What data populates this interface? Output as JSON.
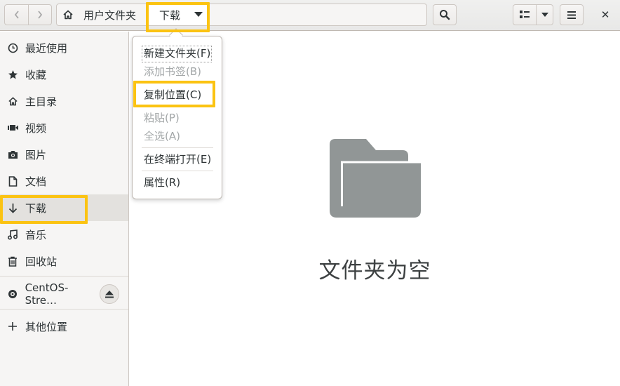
{
  "header": {
    "path_home_label": "用户文件夹",
    "path_current_label": "下载",
    "close_label": "✕"
  },
  "sidebar": {
    "items": [
      {
        "label": "最近使用",
        "icon": "clock-icon"
      },
      {
        "label": "收藏",
        "icon": "star-icon"
      },
      {
        "label": "主目录",
        "icon": "home-icon"
      },
      {
        "label": "视频",
        "icon": "video-icon"
      },
      {
        "label": "图片",
        "icon": "camera-icon"
      },
      {
        "label": "文档",
        "icon": "document-icon"
      },
      {
        "label": "下载",
        "icon": "download-icon"
      },
      {
        "label": "音乐",
        "icon": "music-icon"
      },
      {
        "label": "回收站",
        "icon": "trash-icon"
      }
    ],
    "device_label": "CentOS-Stre…",
    "other_locations_label": "其他位置"
  },
  "context_menu": {
    "items": [
      {
        "label": "新建文件夹(F)",
        "enabled": true
      },
      {
        "label": "添加书签(B)",
        "enabled": false
      },
      {
        "label": "复制位置(C)",
        "enabled": true
      },
      {
        "label": "粘贴(P)",
        "enabled": false
      },
      {
        "label": "全选(A)",
        "enabled": false
      },
      {
        "label": "在终端打开(E)",
        "enabled": true
      },
      {
        "label": "属性(R)",
        "enabled": true
      }
    ]
  },
  "main": {
    "empty_text": "文件夹为空"
  },
  "colors": {
    "highlight": "#fbc312",
    "folder_icon": "#919696",
    "sidebar_bg": "#f6f5f4",
    "selected_bg": "#e3e1de"
  }
}
